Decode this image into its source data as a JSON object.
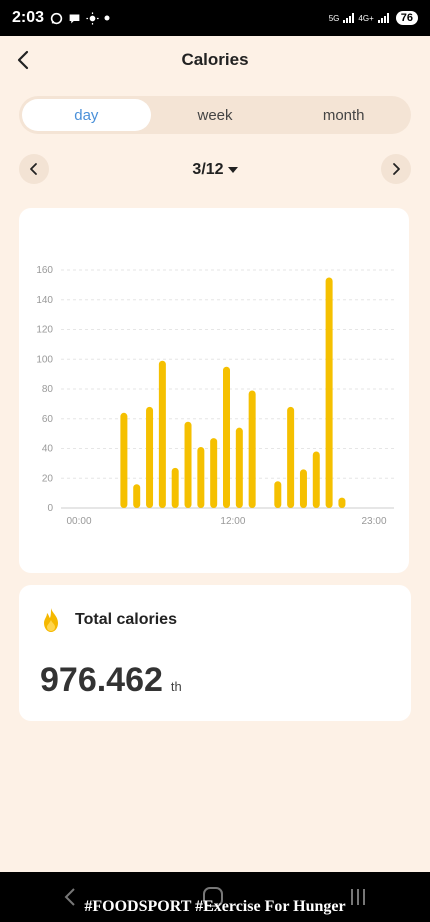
{
  "status": {
    "time": "2:03",
    "net1": "5G",
    "net2": "4G+",
    "battery": "76",
    "icons": [
      "whatsapp-icon",
      "chat-icon",
      "brightness-icon",
      "dot-icon"
    ]
  },
  "header": {
    "title": "Calories",
    "back_icon": "chevron-left-icon"
  },
  "tabs": [
    {
      "label": "day",
      "active": true
    },
    {
      "label": "week",
      "active": false
    },
    {
      "label": "month",
      "active": false
    }
  ],
  "date": {
    "label": "3/12",
    "prev_icon": "chevron-left-icon",
    "next_icon": "chevron-right-icon",
    "dropdown_icon": "caret-down-icon"
  },
  "chart_data": {
    "type": "bar",
    "x_tick_labels": [
      "00:00",
      "12:00",
      "23:00"
    ],
    "y_ticks": [
      0,
      20,
      40,
      60,
      80,
      100,
      120,
      140,
      160
    ],
    "ylim": [
      0,
      160
    ],
    "xlim": [
      0,
      23
    ],
    "grid": true,
    "color": "#f5c000",
    "x": [
      3.5,
      4.5,
      5.5,
      6.5,
      7.5,
      8.5,
      9.5,
      10.5,
      11.5,
      12.5,
      13.5,
      15.5,
      16.5,
      17.5,
      18.5,
      19.5,
      20.5
    ],
    "values": [
      64,
      16,
      68,
      99,
      27,
      58,
      41,
      47,
      95,
      54,
      79,
      18,
      68,
      26,
      38,
      155,
      7
    ]
  },
  "total": {
    "title": "Total calories",
    "icon": "flame-icon",
    "value": "976.462",
    "unit": "th"
  },
  "caption": "#FOODSPORT #Exercise For Hunger",
  "colors": {
    "background": "#fdf1e6",
    "accent": "#4a90d9",
    "bar": "#f5c000",
    "flame": "#f5b800"
  }
}
